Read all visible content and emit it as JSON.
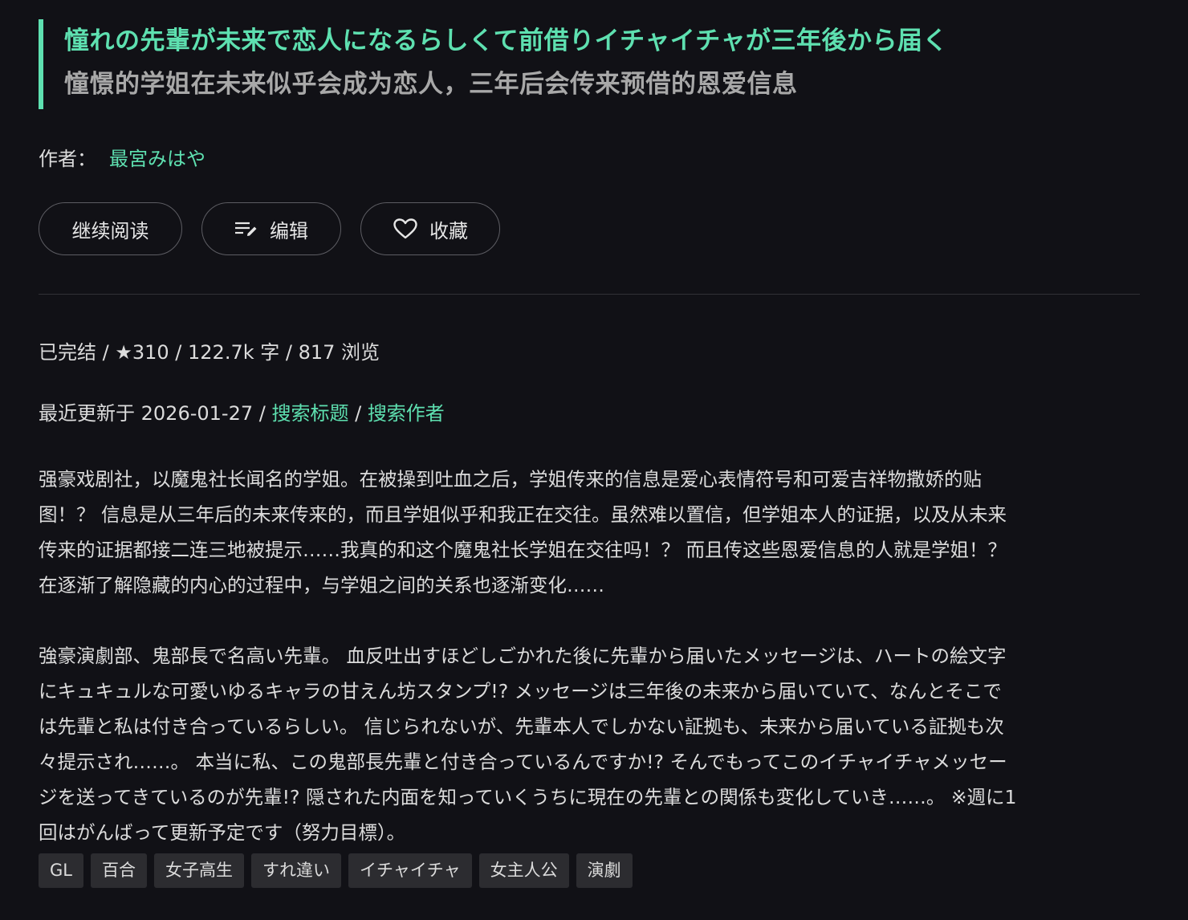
{
  "title": {
    "original": "憧れの先輩が未来で恋人になるらしくて前借りイチャイチャが三年後から届く",
    "translated": "憧憬的学姐在未来似乎会成为恋人，三年后会传来预借的恩爱信息"
  },
  "author": {
    "label": "作者：",
    "name": "最宮みはや"
  },
  "actions": {
    "continue_label": "继续阅读",
    "edit_label": "编辑",
    "favorite_label": "收藏",
    "edit_icon": "edit-list-icon",
    "favorite_icon": "heart-icon"
  },
  "meta": {
    "status": "已完结",
    "sep": " / ",
    "star": "★",
    "rating": "310",
    "words": "122.7k 字",
    "views": "817 浏览"
  },
  "updated": {
    "label": "最近更新于",
    "date": "2026-01-27",
    "sep": " / ",
    "search_title": "搜索标题",
    "search_author": "搜索作者"
  },
  "description": {
    "zh_lines": [
      "强豪戏剧社，以魔鬼社长闻名的学姐。在被操到吐血之后，学姐传来的信息是爱心表情符号和可爱吉祥物撒娇的贴",
      "图！？ 信息是从三年后的未来传来的，而且学姐似乎和我正在交往。虽然难以置信，但学姐本人的证据，以及从未来",
      "传来的证据都接二连三地被提示……我真的和这个魔鬼社长学姐在交往吗！？ 而且传这些恩爱信息的人就是学姐！？",
      "在逐渐了解隐藏的内心的过程中，与学姐之间的关系也逐渐变化……"
    ],
    "jp_lines": [
      "強豪演劇部、鬼部長で名高い先輩。 血反吐出すほどしごかれた後に先輩から届いたメッセージは、ハートの絵文字",
      "にキュキュルな可愛いゆるキャラの甘えん坊スタンプ!? メッセージは三年後の未来から届いていて、なんとそこで",
      "は先輩と私は付き合っているらしい。 信じられないが、先輩本人でしかない証拠も、未来から届いている証拠も次",
      "々提示され……。 本当に私、この鬼部長先輩と付き合っているんですか!? そんでもってこのイチャイチャメッセー",
      "ジを送ってきているのが先輩!? 隠された内面を知っていくうちに現在の先輩との関係も変化していき……。 ※週に1",
      "回はがんばって更新予定です（努力目標）。"
    ]
  },
  "tags": [
    "GL",
    "百合",
    "女子高生",
    "すれ違い",
    "イチャイチャ",
    "女主人公",
    "演劇"
  ],
  "colors": {
    "accent": "#5ee0b0",
    "background": "#111116",
    "tag_bg": "#2c2c30"
  }
}
